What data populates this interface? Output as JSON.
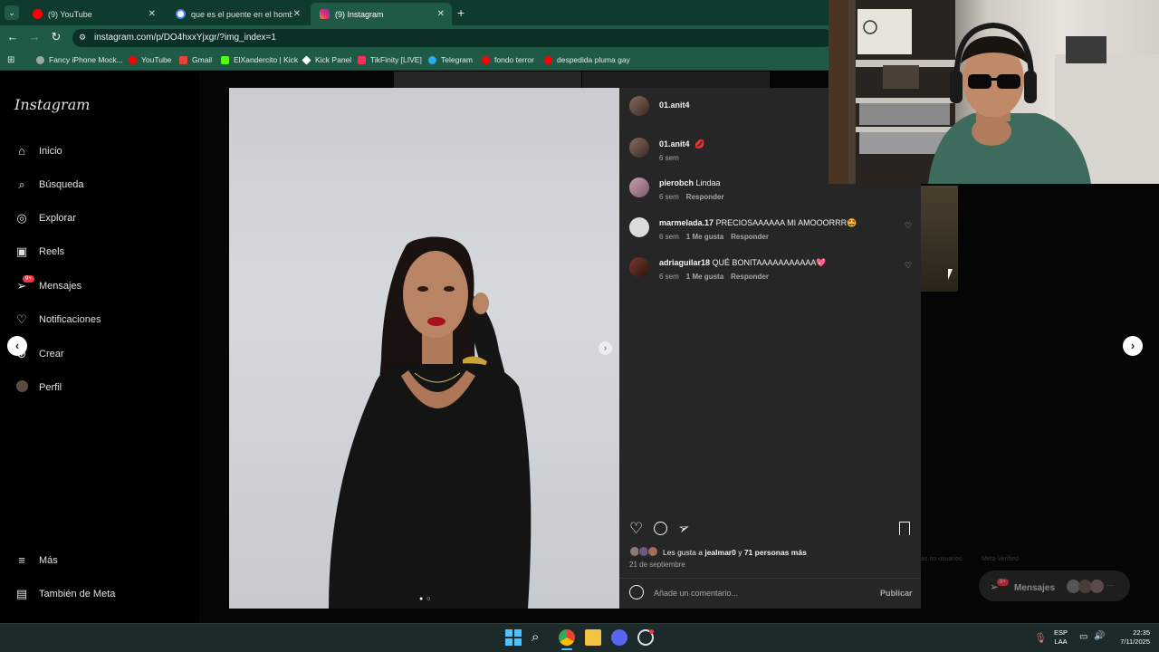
{
  "browser": {
    "tabs": [
      {
        "label": "(9) YouTube",
        "icon": "youtube-icon",
        "active": false
      },
      {
        "label": "que es el puente en el hombre",
        "icon": "google-icon",
        "active": false
      },
      {
        "label": "(9) Instagram",
        "icon": "instagram-icon",
        "active": true
      }
    ],
    "url": "instagram.com/p/DO4hxxYjxgr/?img_index=1",
    "bookmarks": [
      {
        "label": "Fancy iPhone Mock...",
        "color": "#9aa7a3"
      },
      {
        "label": "YouTube",
        "color": "#ff0000"
      },
      {
        "label": "Gmail",
        "color": "#ea4335"
      },
      {
        "label": "ElXandercito | Kick",
        "color": "#53fc18"
      },
      {
        "label": "Kick Panel",
        "color": "#ffffff"
      },
      {
        "label": "TikFinity [LIVE]",
        "color": "#fe2c55"
      },
      {
        "label": "Telegram",
        "color": "#2aabee"
      },
      {
        "label": "fondo terror",
        "color": "#ff0000"
      },
      {
        "label": "despedida pluma gay",
        "color": "#ff0000"
      }
    ]
  },
  "sidebar": {
    "logo": "Instagram",
    "items": [
      {
        "label": "Inicio",
        "icon": "home-icon"
      },
      {
        "label": "Búsqueda",
        "icon": "search-icon"
      },
      {
        "label": "Explorar",
        "icon": "compass-icon"
      },
      {
        "label": "Reels",
        "icon": "reels-icon"
      },
      {
        "label": "Mensajes",
        "icon": "messenger-icon"
      },
      {
        "label": "Notificaciones",
        "icon": "heart-icon"
      },
      {
        "label": "Crear",
        "icon": "plus-icon"
      },
      {
        "label": "Perfil",
        "icon": "avatar-icon"
      }
    ],
    "messages_badge": "9+",
    "more_label": "Más",
    "meta_label": "También de Meta"
  },
  "post": {
    "author": "01.anit4",
    "caption_author": "01.anit4",
    "caption_time": "6 sem",
    "comments": [
      {
        "user": "pierobch",
        "text": "Lindaa",
        "time": "6 sem",
        "likes": "",
        "reply": "Responder"
      },
      {
        "user": "marmelada.17",
        "text": "PRECIOSAAAAAA MI AMOOORRR🤩",
        "time": "6 sem",
        "likes": "1 Me gusta",
        "reply": "Responder"
      },
      {
        "user": "adriaguilar18",
        "text": "QUÉ BONITAAAAAAAAAAA💖",
        "time": "6 sem",
        "likes": "1 Me gusta",
        "reply": "Responder"
      }
    ],
    "likes_prefix": "Les gusta a",
    "likes_user": "jealmar0",
    "likes_connector": "y",
    "likes_others": "71 personas más",
    "date": "21 de septiembre",
    "comment_placeholder": "Añade un comentario...",
    "publish_label": "Publicar"
  },
  "footer_faint": {
    "text1": "as no usuarios",
    "text2": "Meta Verified"
  },
  "messages_float": {
    "label": "Mensajes",
    "badge": "9+"
  },
  "taskbar": {
    "lang_top": "ESP",
    "lang_bottom": "LAA",
    "time": "22:35",
    "date": "7/11/2025"
  }
}
